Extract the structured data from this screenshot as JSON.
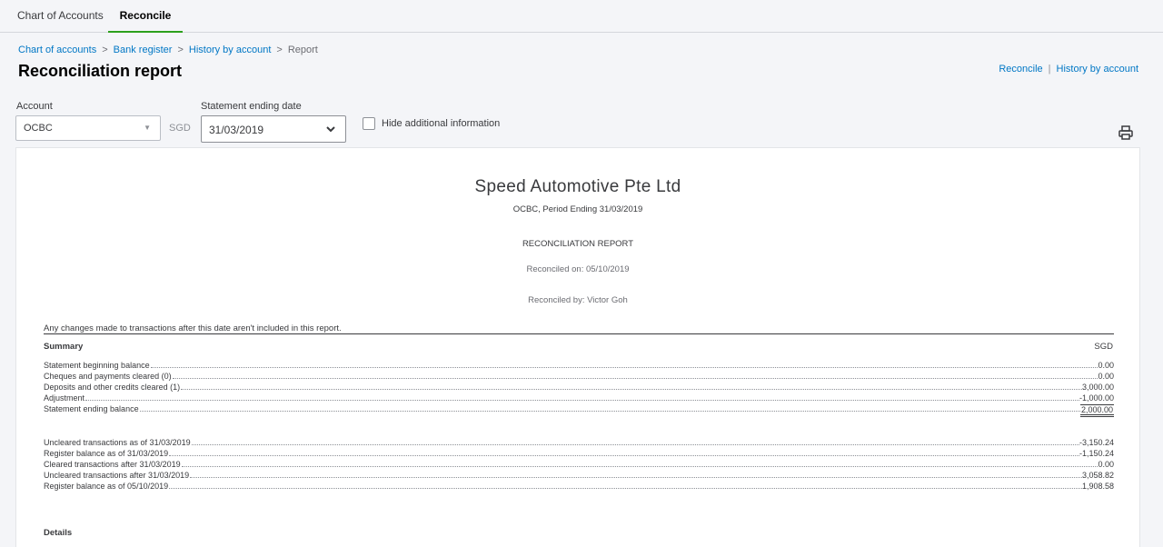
{
  "tabs": [
    {
      "label": "Chart of Accounts"
    },
    {
      "label": "Reconcile",
      "active": true
    }
  ],
  "breadcrumb": {
    "items": [
      "Chart of accounts",
      "Bank register",
      "History by account"
    ],
    "current": "Report",
    "separator": ">"
  },
  "page_title": "Reconciliation report",
  "header_links": {
    "reconcile": "Reconcile",
    "separator": "|",
    "history": "History by account"
  },
  "filters": {
    "account_label": "Account",
    "account_value": "OCBC",
    "currency": "SGD",
    "date_label": "Statement ending date",
    "date_value": "31/03/2019",
    "hide_info_label": "Hide additional information",
    "hide_info_checked": false
  },
  "report": {
    "company": "Speed Automotive Pte Ltd",
    "period": "OCBC, Period Ending 31/03/2019",
    "title": "RECONCILIATION REPORT",
    "reconciled_on": "Reconciled on: 05/10/2019",
    "reconciled_by": "Reconciled by: Victor Goh",
    "note": "Any changes made to transactions after this date aren't included in this report.",
    "summary_heading": "Summary",
    "summary_currency": "SGD",
    "summary": [
      {
        "label": "Statement beginning balance",
        "value": "0.00"
      },
      {
        "label": "Cheques and payments cleared (0)",
        "value": "0.00"
      },
      {
        "label": "Deposits and other credits cleared (1)",
        "value": "3,000.00"
      },
      {
        "label": "Adjustment",
        "value": "-1,000.00"
      },
      {
        "label": "Statement ending balance",
        "value": "2,000.00"
      }
    ],
    "after": [
      {
        "label": "Uncleared transactions as of 31/03/2019",
        "value": "-3,150.24"
      },
      {
        "label": "Register balance as of 31/03/2019",
        "value": "-1,150.24"
      },
      {
        "label": "Cleared transactions after 31/03/2019",
        "value": "0.00"
      },
      {
        "label": "Uncleared transactions after 31/03/2019",
        "value": "3,058.82"
      },
      {
        "label": "Register balance as of 05/10/2019",
        "value": "1,908.58"
      }
    ],
    "details_heading": "Details"
  },
  "colors": {
    "accent_green": "#2ca01c",
    "link_blue": "#0077c5"
  }
}
